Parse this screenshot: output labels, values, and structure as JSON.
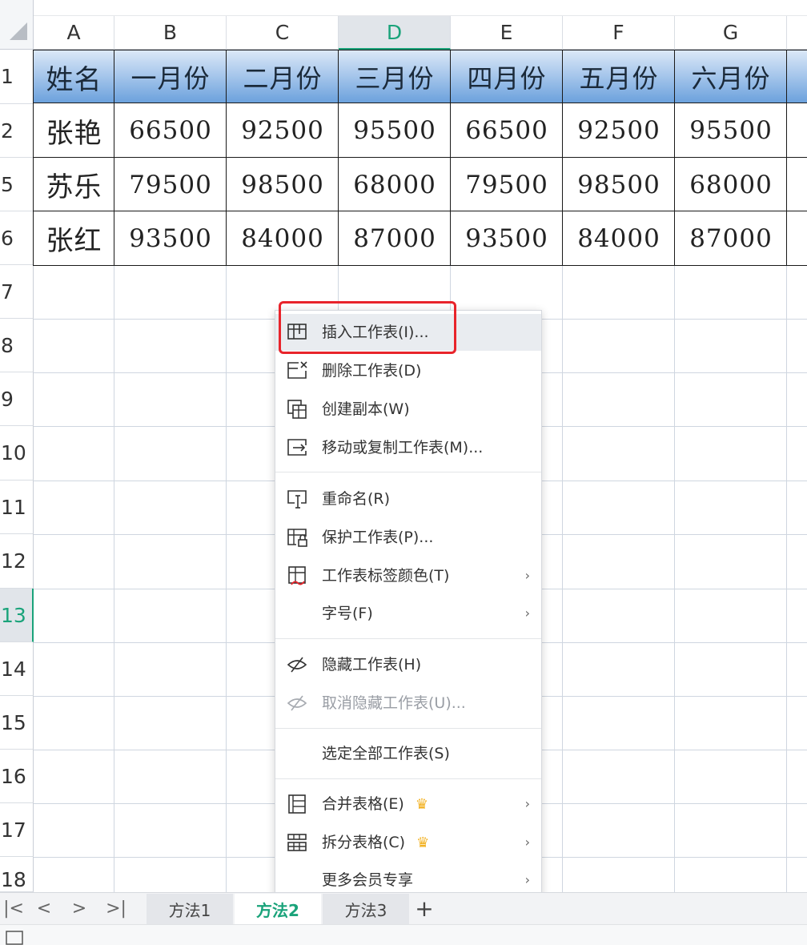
{
  "columns": [
    "A",
    "B",
    "C",
    "D",
    "E",
    "F",
    "G"
  ],
  "active_column": "D",
  "rows": [
    "1",
    "2",
    "5",
    "6",
    "7",
    "8",
    "9",
    "10",
    "11",
    "12",
    "13",
    "14",
    "15",
    "16",
    "17",
    "18"
  ],
  "active_row": "13",
  "table": {
    "header": [
      "姓名",
      "一月份",
      "二月份",
      "三月份",
      "四月份",
      "五月份",
      "六月份"
    ],
    "rows": [
      [
        "张艳",
        "66500",
        "92500",
        "95500",
        "66500",
        "92500",
        "95500"
      ],
      [
        "苏乐",
        "79500",
        "98500",
        "68000",
        "79500",
        "98500",
        "68000"
      ],
      [
        "张红",
        "93500",
        "84000",
        "87000",
        "93500",
        "84000",
        "87000"
      ]
    ]
  },
  "context_menu": {
    "items": [
      {
        "label": "插入工作表(I)...",
        "icon": "insert-sheet-icon",
        "highlighted": true
      },
      {
        "label": "删除工作表(D)",
        "icon": "delete-sheet-icon"
      },
      {
        "label": "创建副本(W)",
        "icon": "copy-sheet-icon"
      },
      {
        "label": "移动或复制工作表(M)...",
        "icon": "move-sheet-icon"
      },
      {
        "label": "重命名(R)",
        "icon": "rename-icon"
      },
      {
        "label": "保护工作表(P)...",
        "icon": "protect-sheet-icon"
      },
      {
        "label": "工作表标签颜色(T)",
        "icon": "tab-color-icon",
        "submenu": true
      },
      {
        "label": "字号(F)",
        "submenu": true
      },
      {
        "label": "隐藏工作表(H)",
        "icon": "hide-icon"
      },
      {
        "label": "取消隐藏工作表(U)...",
        "icon": "unhide-icon",
        "disabled": true
      },
      {
        "label": "选定全部工作表(S)"
      },
      {
        "label": "合并表格(E)",
        "icon": "merge-table-icon",
        "premium": true,
        "submenu": true
      },
      {
        "label": "拆分表格(C)",
        "icon": "split-table-icon",
        "premium": true,
        "submenu": true
      },
      {
        "label": "更多会员专享",
        "submenu": true
      }
    ],
    "submenu_glyph": "›",
    "crown_glyph": "♛"
  },
  "sheet_tabs": [
    {
      "label": "方法1",
      "active": false
    },
    {
      "label": "方法2",
      "active": true
    },
    {
      "label": "方法3",
      "active": false
    }
  ],
  "nav_glyphs": {
    "first": "|<",
    "prev": "<",
    "next": ">",
    "last": ">|",
    "add": "+"
  },
  "colors": {
    "accent": "#1aa37a",
    "highlight_box": "#e8242b",
    "header_blue": "#6aa0dc",
    "crown": "#f2b01e"
  }
}
